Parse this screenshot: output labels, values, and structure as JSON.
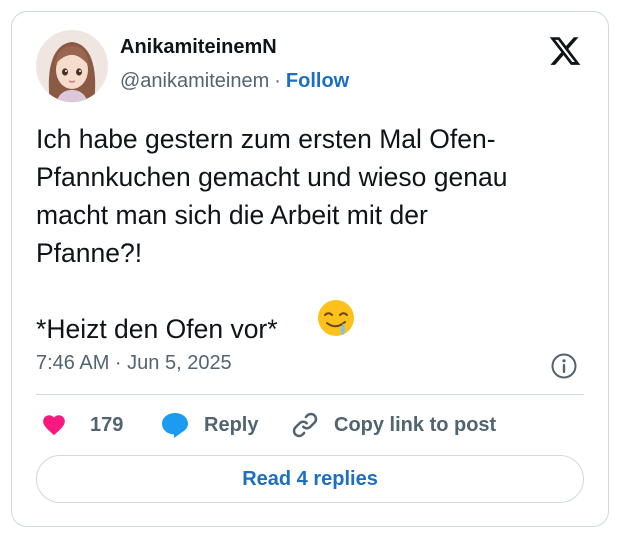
{
  "author": {
    "display_name": "AnikamiteinemN",
    "handle": "@anikamiteinem",
    "separator": "·",
    "follow_label": "Follow",
    "avatar_icon": "avatar-anime-girl"
  },
  "platform_icon": "x-logo-icon",
  "tweet": {
    "text": "Ich habe gestern zum ersten Mal Ofen-\nPfannkuchen gemacht und wieso genau\nmacht man sich die Arbeit mit der\nPfanne?!\n\n*Heizt den Ofen vor*",
    "emoji": "drooling-face-emoji",
    "timestamp": "7:46 AM · Jun 5, 2025"
  },
  "actions": {
    "like_count": "179",
    "reply_label": "Reply",
    "copy_link_label": "Copy link to post"
  },
  "read_replies_label": "Read 4 replies",
  "colors": {
    "link_blue": "#1d6fc4",
    "heart_pink": "#f91880",
    "reply_blue": "#1d9bf0",
    "muted_text": "#536471",
    "border": "#cfd9de"
  }
}
